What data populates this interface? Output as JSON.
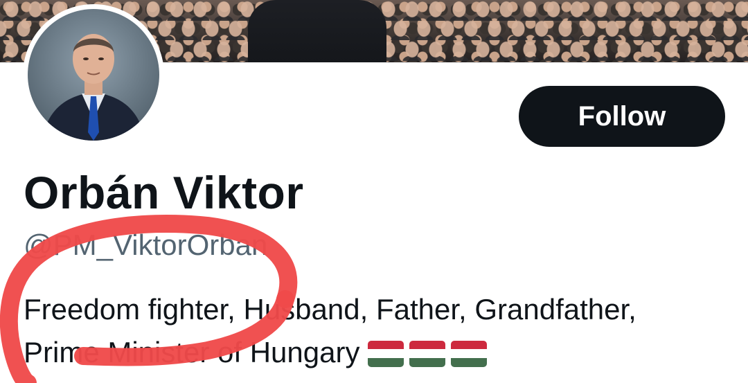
{
  "profile": {
    "display_name": "Orbán Viktor",
    "handle": "@PM_ViktorOrban",
    "bio_line1": "Freedom fighter, Husband, Father, Grandfather,",
    "bio_line2": "Prime Minister of Hungary",
    "bio_flags": [
      "flag-hungary",
      "flag-hungary",
      "flag-hungary"
    ]
  },
  "actions": {
    "follow_label": "Follow"
  },
  "colors": {
    "button_bg": "#0f1419",
    "button_text": "#ffffff",
    "handle_text": "#536471",
    "annotation": "#ef4a4a",
    "flag_red": "#cd2a3e",
    "flag_green": "#436f4d"
  }
}
